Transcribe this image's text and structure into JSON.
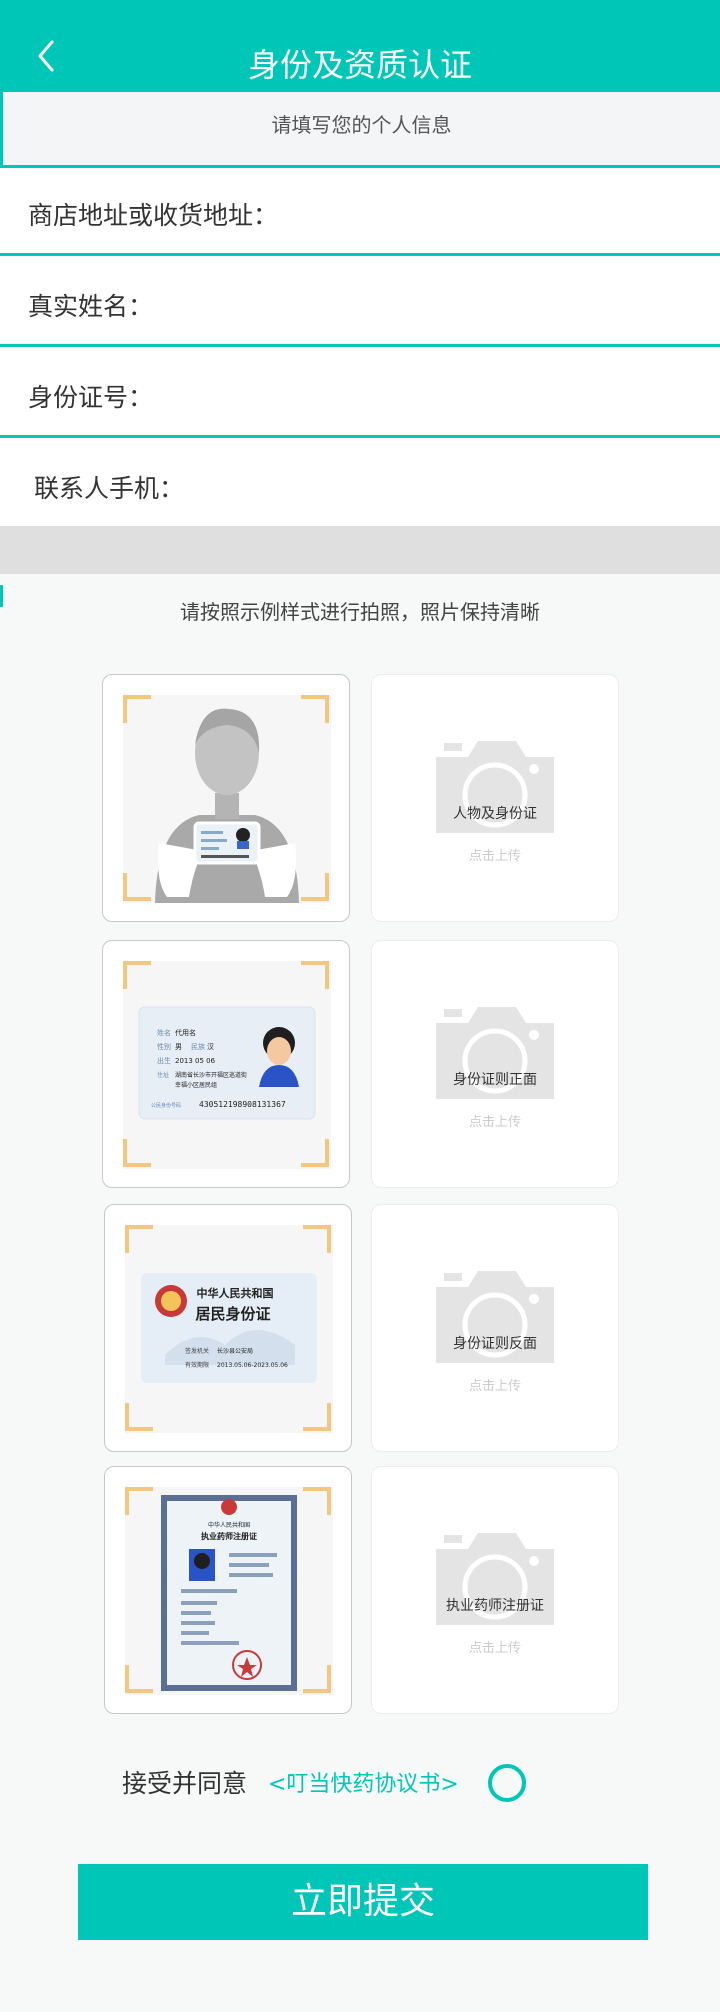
{
  "header": {
    "title": "身份及资质认证"
  },
  "subheader": {
    "text": "请填写您的个人信息"
  },
  "form": {
    "address_label": "商店地址或收货地址：",
    "name_label": "真实姓名：",
    "id_label": "身份证号：",
    "phone_label": "联系人手机：",
    "address_value": "",
    "name_value": "",
    "id_value": "",
    "phone_value": ""
  },
  "photo_hint": "请按照示例样式进行拍照，照片保持清晰",
  "uploads": [
    {
      "label": "人物及身份证",
      "sub": "点击上传"
    },
    {
      "label": "身份证则正面",
      "sub": "点击上传"
    },
    {
      "label": "身份证则反面",
      "sub": "点击上传"
    },
    {
      "label": "执业药师注册证",
      "sub": "点击上传"
    }
  ],
  "samples": {
    "front": {
      "name_key": "姓名",
      "name_val": "代用名",
      "sex_key": "性别",
      "sex_val": "男",
      "ethnic_key": "民族",
      "ethnic_val": "汉",
      "birth_key": "出生",
      "birth_val": "2013 05 06",
      "addr_key": "住址",
      "addr_val": "湖南省长沙市开福区巡道街",
      "addr_val2": "幸福小区居民组",
      "id_key": "公民身份号码",
      "id_val": "430512198908131367"
    },
    "back": {
      "country": "中华人民共和国",
      "card_name": "居民身份证",
      "authority_key": "签发机关",
      "authority_val": "长沙县公安局",
      "validity_key": "有效期限",
      "validity_val": "2013.05.06-2023.05.06"
    },
    "cert": {
      "country": "中华人民共和国",
      "title": "执业药师注册证"
    }
  },
  "agreement": {
    "prefix": "接受并同意",
    "link": "<叮当快药协议书>"
  },
  "submit_label": "立即提交",
  "colors": {
    "accent": "#00c6b8",
    "corner": "#f5c680"
  }
}
